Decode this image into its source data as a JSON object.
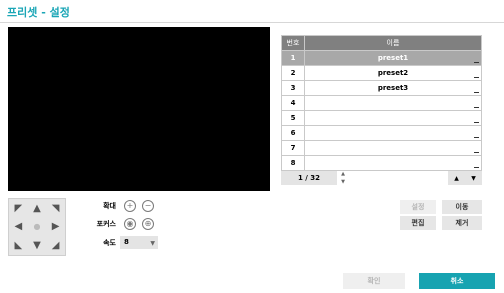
{
  "dialog": {
    "title": "프리셋 - 설정"
  },
  "preset_table": {
    "headers": {
      "number": "번호",
      "name": "이름"
    },
    "rows": [
      {
        "num": "1",
        "name": "preset1",
        "selected": true
      },
      {
        "num": "2",
        "name": "preset2",
        "selected": false
      },
      {
        "num": "3",
        "name": "preset3",
        "selected": false
      },
      {
        "num": "4",
        "name": "",
        "selected": false
      },
      {
        "num": "5",
        "name": "",
        "selected": false
      },
      {
        "num": "6",
        "name": "",
        "selected": false
      },
      {
        "num": "7",
        "name": "",
        "selected": false
      },
      {
        "num": "8",
        "name": "",
        "selected": false
      }
    ],
    "page_indicator": "1 / 32"
  },
  "ptz": {
    "zoom_label": "확대",
    "focus_label": "포커스",
    "speed_label": "속도",
    "speed_value": "8"
  },
  "actions": {
    "set_label": "설정",
    "move_label": "이동",
    "edit_label": "편집",
    "remove_label": "제거"
  },
  "footer": {
    "ok_label": "확인",
    "cancel_label": "취소"
  },
  "colors": {
    "accent": "#1ba6b6"
  }
}
